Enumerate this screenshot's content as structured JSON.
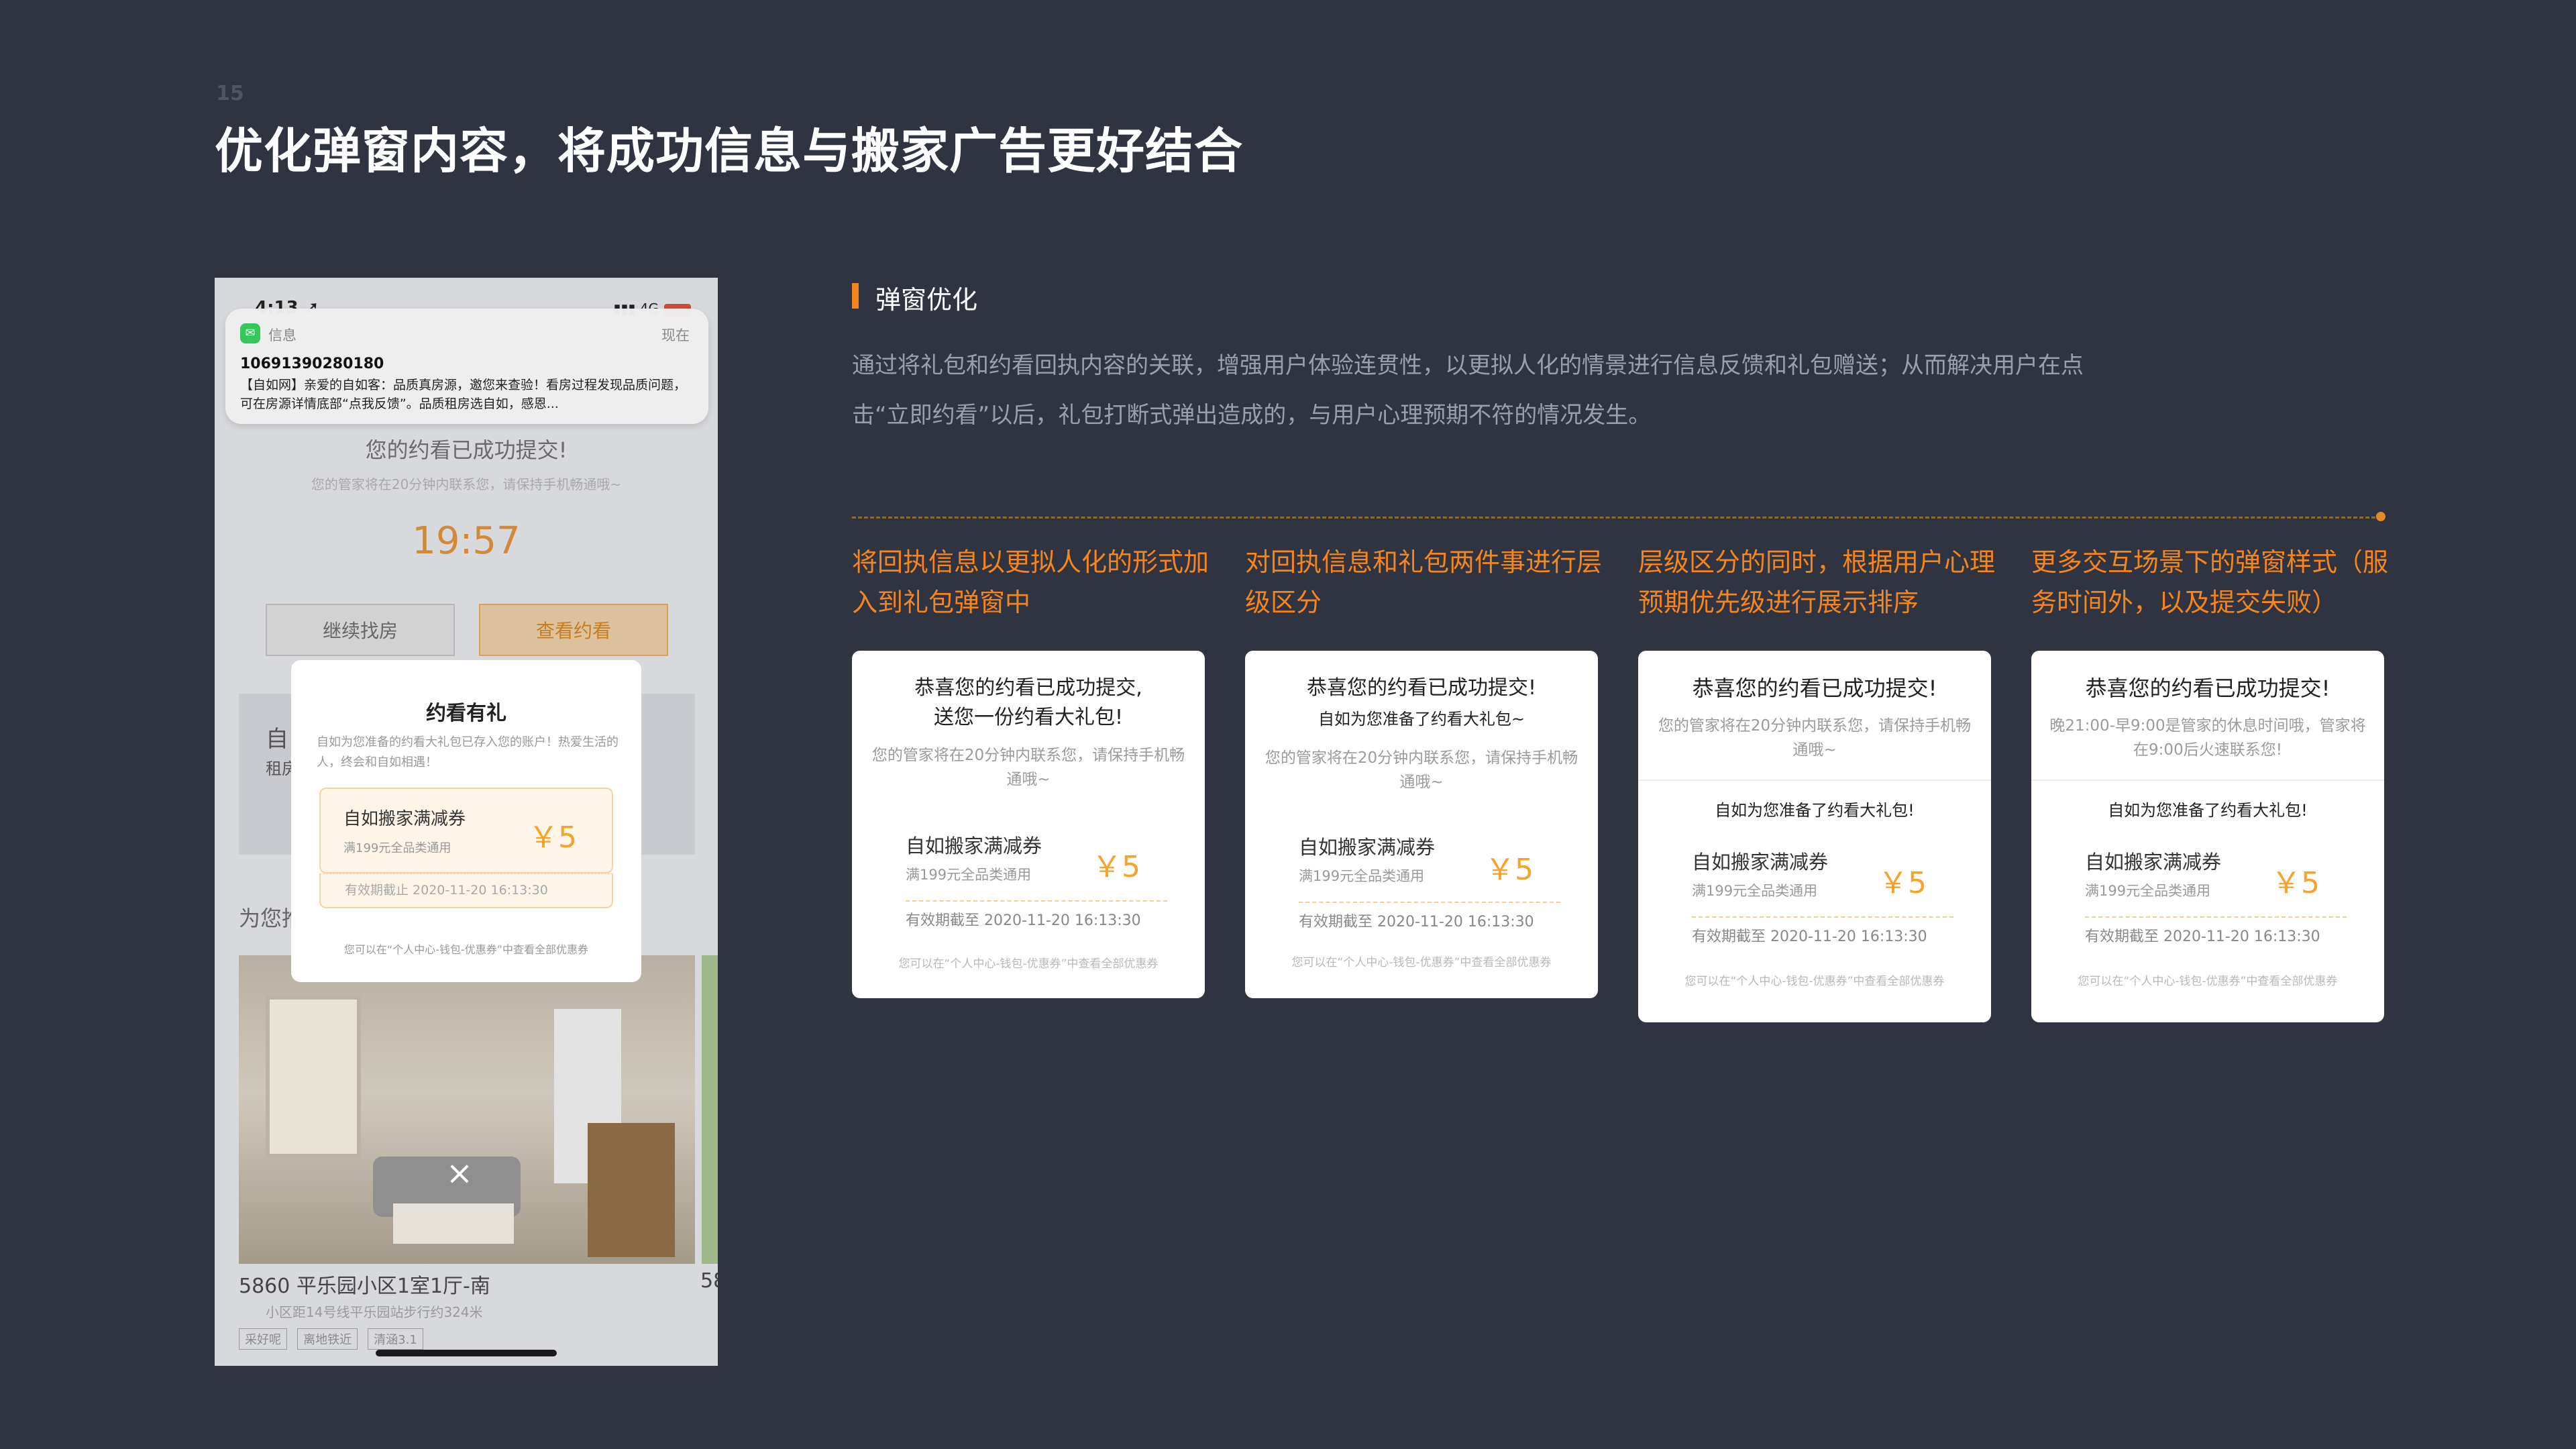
{
  "page": {
    "number": "15",
    "title": "优化弹窗内容，将成功信息与搬家广告更好结合"
  },
  "phone": {
    "status_time": "4:13 ➚",
    "status_right": "▮▮▮ 4G",
    "notification": {
      "app": "信息",
      "time": "现在",
      "sender": "10691390280180",
      "body": "【自如网】亲爱的自如客：品质真房源，邀您来查验！看房过程发现品质问题，可在房源详情底部“点我反馈”。品质租房选自如，感恩..."
    },
    "success_title": "您的约看已成功提交!",
    "success_sub": "您的管家将在20分钟内联系您，请保持手机畅通哦~",
    "countdown": "19:57",
    "btn_continue": "继续找房",
    "btn_view": "查看约看",
    "bg_card_text": "自",
    "bg_card_text2": "租房",
    "section_label": "为您推",
    "listing": {
      "title": "5860   平乐园小区1室1厅-南",
      "title_2": "58",
      "sub": "小区距14号线平乐园站步行约324米",
      "tags": [
        "采好呢",
        "离地铁近",
        "清涵3.1"
      ]
    },
    "close_icon": "×",
    "modal": {
      "title": "约看有礼",
      "desc": "自如为您准备的约看大礼包已存入您的账户！热爱生活的人，终会和自如相遇！",
      "coupon_name": "自如搬家满减券",
      "coupon_cond": "满199元全品类通用",
      "coupon_value": "￥5",
      "expiry": "有效期截止 2020-11-20 16:13:30",
      "footer": "您可以在“个人中心-钱包-优惠券”中查看全部优惠券"
    }
  },
  "section": {
    "title": "弹窗优化",
    "description": "通过将礼包和约看回执内容的关联，增强用户体验连贯性，以更拟人化的情景进行信息反馈和礼包赠送；从而解决用户在点击“立即约看”以后，礼包打断式弹出造成的，与用户心理预期不符的情况发生。"
  },
  "columns": [
    {
      "label": "将回执信息以更拟人化的形式加入到礼包弹窗中",
      "card": {
        "title_line1": "恭喜您的约看已成功提交,",
        "title_line2": "送您一份约看大礼包!",
        "sub": "您的管家将在20分钟内联系您，请保持手机畅通哦~",
        "gift": "",
        "coupon_name": "自如搬家满减券",
        "coupon_cond": "满199元全品类通用",
        "coupon_value": "￥5",
        "expiry": "有效期截至 2020-11-20 16:13:30",
        "footer": "您可以在“个人中心-钱包-优惠券”中查看全部优惠券"
      }
    },
    {
      "label": "对回执信息和礼包两件事进行层级区分",
      "card": {
        "title_line1": "恭喜您的约看已成功提交!",
        "title_line2": "自如为您准备了约看大礼包~",
        "sub": "您的管家将在20分钟内联系您，请保持手机畅通哦~",
        "gift": "",
        "coupon_name": "自如搬家满减券",
        "coupon_cond": "满199元全品类通用",
        "coupon_value": "￥5",
        "expiry": "有效期截至 2020-11-20 16:13:30",
        "footer": "您可以在“个人中心-钱包-优惠券”中查看全部优惠券"
      }
    },
    {
      "label": "层级区分的同时，根据用户心理预期优先级进行展示排序",
      "card": {
        "title_line1": "恭喜您的约看已成功提交!",
        "title_line2": "",
        "sub": "您的管家将在20分钟内联系您，请保持手机畅通哦~",
        "gift": "自如为您准备了约看大礼包!",
        "coupon_name": "自如搬家满减券",
        "coupon_cond": "满199元全品类通用",
        "coupon_value": "￥5",
        "expiry": "有效期截至 2020-11-20 16:13:30",
        "footer": "您可以在“个人中心-钱包-优惠券”中查看全部优惠券"
      }
    },
    {
      "label": "更多交互场景下的弹窗样式（服务时间外，以及提交失败）",
      "card": {
        "title_line1": "恭喜您的约看已成功提交!",
        "title_line2": "",
        "sub": "晚21:00-早9:00是管家的休息时间哦，管家将在9:00后火速联系您!",
        "gift": "自如为您准备了约看大礼包!",
        "coupon_name": "自如搬家满减券",
        "coupon_cond": "满199元全品类通用",
        "coupon_value": "￥5",
        "expiry": "有效期截至 2020-11-20 16:13:30",
        "footer": "您可以在“个人中心-钱包-优惠券”中查看全部优惠券"
      }
    }
  ],
  "colors": {
    "background": "#2f3440",
    "accent": "#f5851f",
    "coupon_value": "#f5a42b"
  }
}
